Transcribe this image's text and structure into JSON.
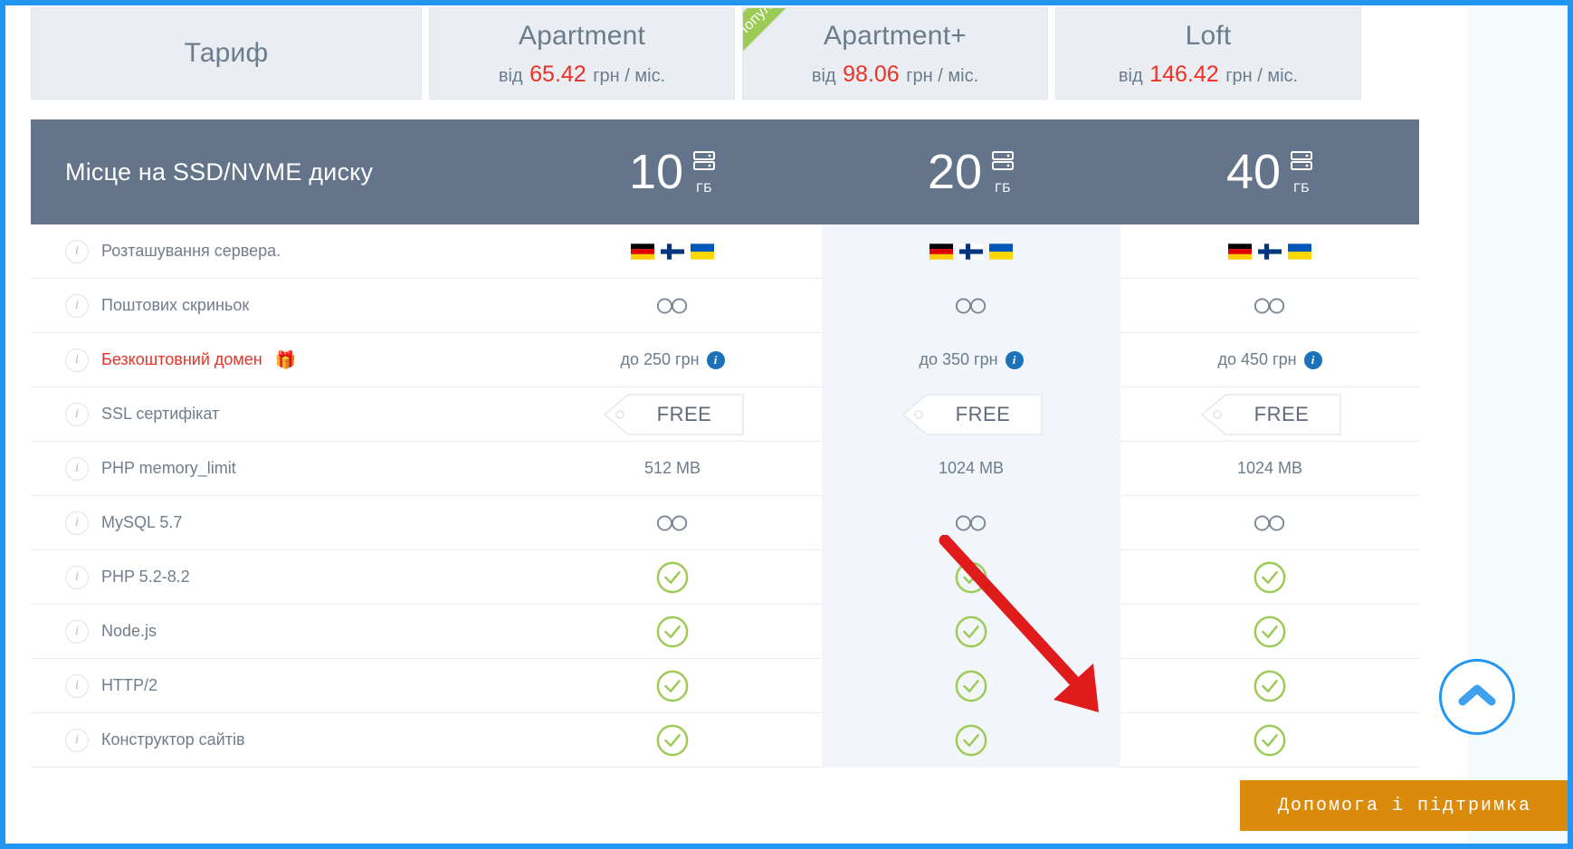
{
  "theme": {
    "frame_border": "#2196f3",
    "header_bg": "#eaeef3",
    "dark_row_bg": "#64748a",
    "accent_price": "#ee3124",
    "ribbon_bg": "#9ccb57",
    "check_green": "#9ccb57",
    "info_blue": "#1b72b8",
    "support_orange": "#db8b0b",
    "shade_col": "#f2f5f9"
  },
  "plans": {
    "label_column_title": "Тариф",
    "items": [
      {
        "name": "Apartment",
        "price_prefix": "від",
        "price": "65.42",
        "price_suffix": "грн / міс.",
        "popular": false,
        "badge": ""
      },
      {
        "name": "Apartment+",
        "price_prefix": "від",
        "price": "98.06",
        "price_suffix": "грн / міс.",
        "popular": true,
        "badge": "Популярний"
      },
      {
        "name": "Loft",
        "price_prefix": "від",
        "price": "146.42",
        "price_suffix": "грн / міс.",
        "popular": false,
        "badge": ""
      }
    ]
  },
  "ssd_row": {
    "label": "Місце на SSD/NVME диску",
    "unit": "ГБ",
    "values": [
      "10",
      "20",
      "40"
    ],
    "icon": "server-disk-icon"
  },
  "features": [
    {
      "label": "Розташування сервера.",
      "highlight": false,
      "type": "flags",
      "values": [
        [
          "germany-flag",
          "finland-flag",
          "ukraine-flag"
        ],
        [
          "germany-flag",
          "finland-flag",
          "ukraine-flag"
        ],
        [
          "germany-flag",
          "finland-flag",
          "ukraine-flag"
        ]
      ]
    },
    {
      "label": "Поштових скриньок",
      "highlight": false,
      "type": "infinity",
      "values": [
        "infinity-icon",
        "infinity-icon",
        "infinity-icon"
      ]
    },
    {
      "label": "Безкоштовний домен",
      "label_suffix_icon": "gift-icon",
      "highlight": true,
      "type": "text-info",
      "values": [
        "до 250 грн",
        "до 350 грн",
        "до 450 грн"
      ]
    },
    {
      "label": "SSL сертифікат",
      "highlight": false,
      "type": "tag",
      "values": [
        "FREE",
        "FREE",
        "FREE"
      ]
    },
    {
      "label": "PHP memory_limit",
      "highlight": false,
      "type": "text",
      "values": [
        "512 MB",
        "1024 MB",
        "1024 MB"
      ]
    },
    {
      "label": "MySQL 5.7",
      "highlight": false,
      "type": "infinity",
      "values": [
        "infinity-icon",
        "infinity-icon",
        "infinity-icon"
      ]
    },
    {
      "label": "PHP 5.2-8.2",
      "highlight": false,
      "type": "check",
      "values": [
        "check-icon",
        "check-icon",
        "check-icon"
      ]
    },
    {
      "label": "Node.js",
      "highlight": false,
      "type": "check",
      "values": [
        "check-icon",
        "check-icon",
        "check-icon"
      ]
    },
    {
      "label": "HTTP/2",
      "highlight": false,
      "type": "check",
      "values": [
        "check-icon",
        "check-icon",
        "check-icon"
      ]
    },
    {
      "label": "Конструктор сайтів",
      "highlight": false,
      "type": "check",
      "values": [
        "check-icon",
        "check-icon",
        "check-icon"
      ]
    }
  ],
  "annotation": {
    "arrow": "red-arrow-annotation",
    "color": "#e01b1b"
  },
  "widgets": {
    "scroll_top": {
      "icon": "chevron-up-icon",
      "color": "#2196f3"
    },
    "support_button": {
      "label": "Допомога і підтримка"
    }
  }
}
